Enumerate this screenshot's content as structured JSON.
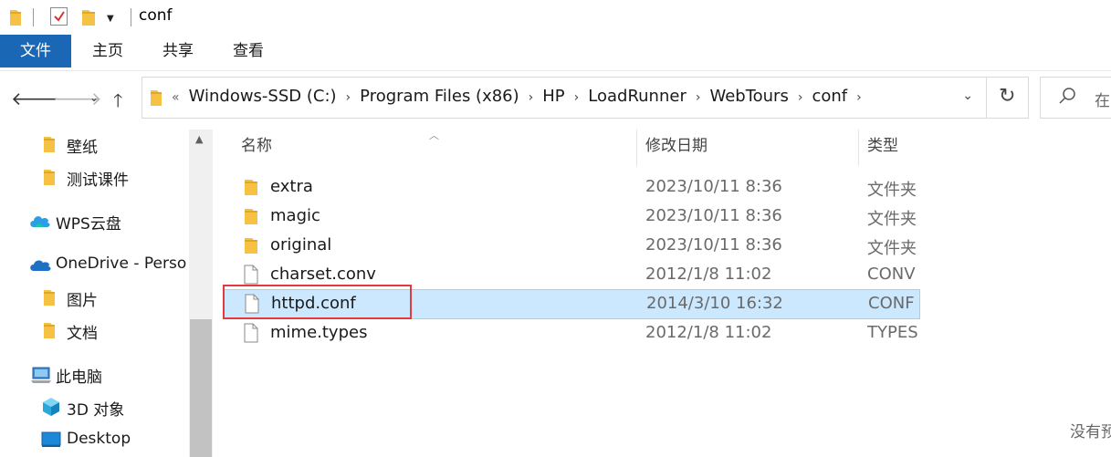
{
  "window": {
    "title": "conf"
  },
  "ribbon": {
    "tabs": [
      "文件",
      "主页",
      "共享",
      "查看"
    ]
  },
  "address": {
    "overflow": "«",
    "crumbs": [
      "Windows-SSD (C:)",
      "Program Files (x86)",
      "HP",
      "LoadRunner",
      "WebTours",
      "conf"
    ]
  },
  "search": {
    "placeholder": "在"
  },
  "nav": {
    "items": [
      {
        "label": "壁纸",
        "icon": "folder-icon"
      },
      {
        "label": "测试课件",
        "icon": "folder-icon"
      },
      {
        "label": "WPS云盘",
        "icon": "wps-cloud-icon"
      },
      {
        "label": "OneDrive - Perso",
        "icon": "onedrive-cloud-icon"
      },
      {
        "label": "图片",
        "icon": "folder-icon"
      },
      {
        "label": "文档",
        "icon": "folder-icon"
      },
      {
        "label": "此电脑",
        "icon": "computer-icon"
      },
      {
        "label": "3D 对象",
        "icon": "3d-objects-icon"
      },
      {
        "label": "Desktop",
        "icon": "desktop-icon"
      }
    ]
  },
  "columns": {
    "name": "名称",
    "date": "修改日期",
    "type": "类型"
  },
  "files": [
    {
      "name": "extra",
      "date": "2023/10/11 8:36",
      "type": "文件夹",
      "icon": "folder-icon"
    },
    {
      "name": "magic",
      "date": "2023/10/11 8:36",
      "type": "文件夹",
      "icon": "folder-icon"
    },
    {
      "name": "original",
      "date": "2023/10/11 8:36",
      "type": "文件夹",
      "icon": "folder-icon"
    },
    {
      "name": "charset.conv",
      "date": "2012/1/8 11:02",
      "type": "CONV",
      "icon": "file-icon"
    },
    {
      "name": "httpd.conf",
      "date": "2014/3/10 16:32",
      "type": "CONF",
      "icon": "file-icon"
    },
    {
      "name": "mime.types",
      "date": "2012/1/8 11:02",
      "type": "TYPES",
      "icon": "file-icon"
    }
  ],
  "status": {
    "preview": "没有预"
  },
  "colors": {
    "accent": "#1a67b6",
    "selection": "#cce8ff",
    "highlight_box": "#e03c3c",
    "folder": "#f5c243"
  }
}
